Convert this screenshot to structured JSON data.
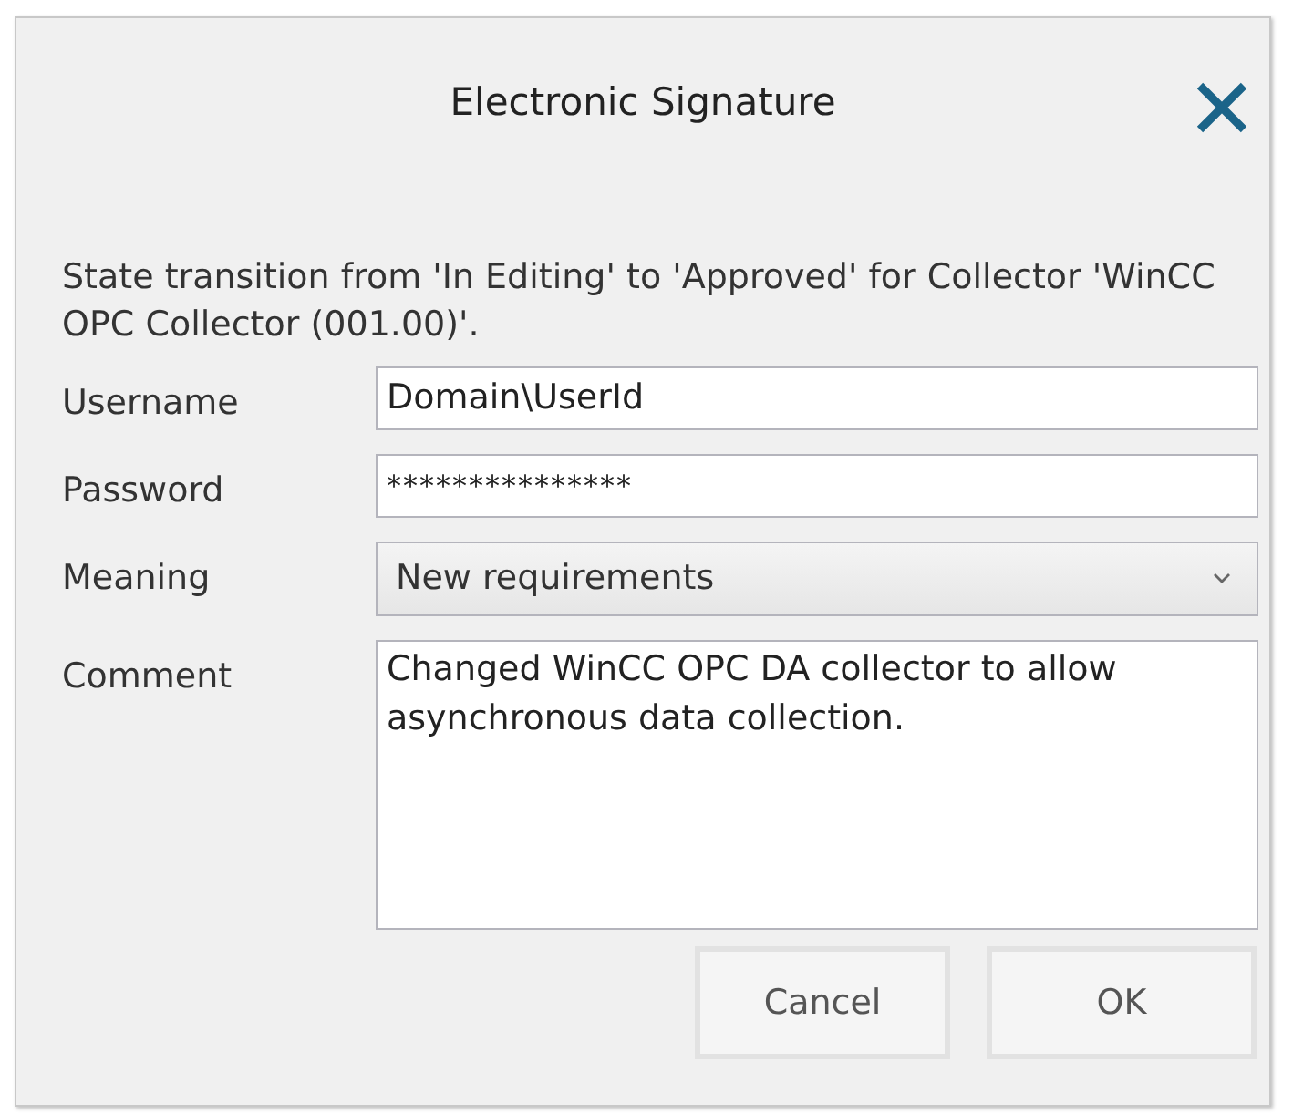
{
  "window": {
    "title": "Electronic Signature"
  },
  "message": "State transition from 'In Editing' to 'Approved' for Collector 'WinCC OPC Collector (001.00)'.",
  "fields": [
    {
      "label": "Username",
      "kind": "text",
      "value": "Domain\\UserId"
    },
    {
      "label": "Password",
      "kind": "password",
      "value": "***************"
    },
    {
      "label": "Meaning",
      "kind": "select",
      "value": "New requirements"
    },
    {
      "label": "Comment",
      "kind": "textarea",
      "value": "Changed WinCC OPC DA collector to allow asynchronous data collection."
    }
  ],
  "buttons": [
    "Cancel",
    "OK"
  ]
}
